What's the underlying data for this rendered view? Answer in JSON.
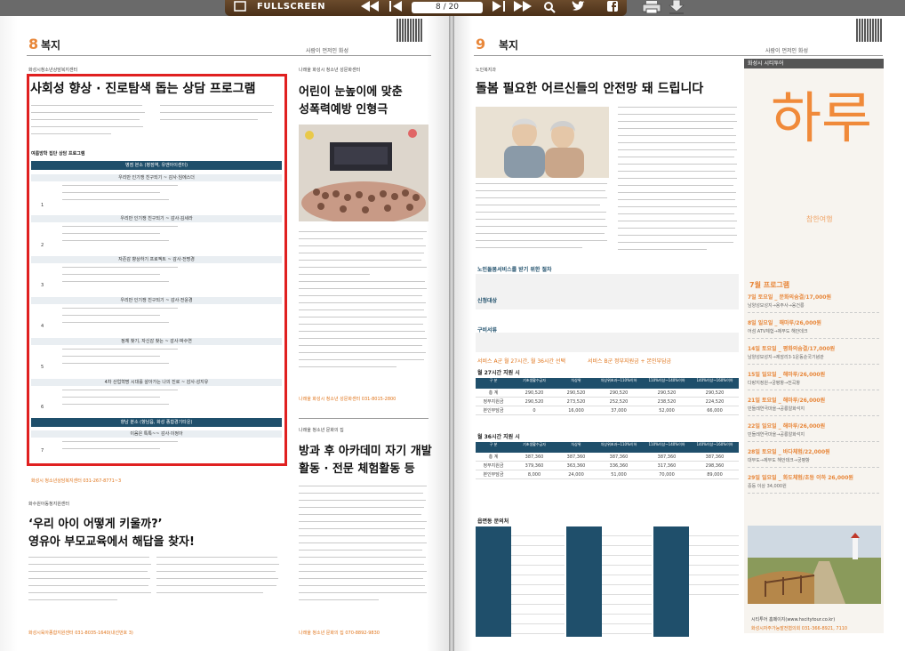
{
  "viewer": {
    "fullscreen_label": "FULLSCREEN",
    "page_counter": "8 / 20"
  },
  "left_page": {
    "number": "8",
    "section": "복지",
    "header_tag": "사람이 먼저인 화성",
    "top_tag": "화성시청소년상담복지센터",
    "article1": {
      "title": "사회성 향상 · 진로탐색 돕는 상담 프로그램",
      "table_caption": "여름방학 집단 상담 프로그램",
      "bar_main": "병점 본소 (병점역, 유앤아이센터)",
      "rows": [
        {
          "num": "1",
          "head": "우리만 인기쟁 친구되기 ~ 감사·임에스더"
        },
        {
          "num": "2",
          "head": "우리만 인기쟁 친구되기 ~ 감사·김세라"
        },
        {
          "num": "3",
          "head": "자존감 향상하기 프로젝트 ~ 감사·전명경"
        },
        {
          "num": "4",
          "head": "우리만 인기쟁 친구되기 ~ 감사·전윤경"
        },
        {
          "num": "5",
          "head": "정체 찾기, 자신감 찾는 ~ 감사·박수연"
        },
        {
          "num": "6",
          "head": "4차 산업혁명 시대를 살아가는 나의 진로 ~ 감사·성지유"
        }
      ],
      "bar_second": "향남 분소 (향남읍, 화성 종합경기타운)",
      "sub_second": "이음은 톡톡~~ 감사·이정아",
      "row7": {
        "num": "7"
      },
      "contact": "화성시 청소년상담복지센터 031-267-8771~3"
    },
    "article2": {
      "tag": "나래울 화성시 청소년 성문화센터",
      "title_lines": [
        "어린이 눈높이에 맞춘",
        "성폭력예방 인형극"
      ],
      "contact": "나래울 화성시 청소년 성문화센터 031-8015-2800"
    },
    "article3": {
      "tag": "화수원아동청지원센터",
      "title_lines": [
        "‘우리 아이 어떻게 키울까?’",
        "영유아 부모교육에서 해답을 찾자!"
      ],
      "contact": "화성시육아종합지원센터 031-8035-1640(내선번호 3)"
    },
    "article4": {
      "tag": "나래울 청소년 문화의 집",
      "title_lines": [
        "방과 후 아카데미 자기 개발",
        "활동 · 전문 체험활동 등"
      ],
      "contact": "나래울 청소년 문화의 집 070-8892-9830"
    }
  },
  "right_page": {
    "number": "9",
    "section": "복지",
    "header_tag": "사람이 먼저인 화성",
    "top_tag": "노인복지과",
    "article1": {
      "title": "돌봄 필요한 어르신들의 안전망 돼 드립니다",
      "sub_service": "노인돌봄서비스를 받기 위한 절차",
      "sub_target": "신청대상",
      "sub_area": "구비서류",
      "service_a": "서비스 A군 월 27시간, 월 36시간 선택",
      "service_b": "서비스 B군 정부지원금 + 본인부담금",
      "table1_title": "월 27시간 지원 시",
      "table2_title": "월 36시간 지원 시",
      "table_headers": [
        "구 분",
        "기초생활수급자",
        "차상위",
        "차상위초과~110%이하",
        "110%이상~140%이하",
        "140%이상~160%이하"
      ],
      "table1_rows": [
        [
          "총 계",
          "290,520",
          "290,520",
          "290,520",
          "290,520",
          "290,520"
        ],
        [
          "정부지원금",
          "290,520",
          "273,520",
          "252,520",
          "238,520",
          "224,520"
        ],
        [
          "본인부담금",
          "0",
          "16,000",
          "37,000",
          "52,000",
          "66,000"
        ]
      ],
      "table2_rows": [
        [
          "총 계",
          "387,360",
          "387,360",
          "387,360",
          "387,360",
          "387,360"
        ],
        [
          "정부지원금",
          "379,360",
          "363,360",
          "336,360",
          "317,360",
          "298,360"
        ],
        [
          "본인부담금",
          "8,000",
          "24,000",
          "51,000",
          "70,000",
          "89,000"
        ]
      ],
      "contact_title": "읍면동 문의처"
    },
    "sidebar": {
      "head": "화성시 시티투어",
      "brand": "하루",
      "brand_sub": "참한여행",
      "program_title": "7월 프로그램",
      "programs": [
        {
          "date": "7일 토요일 _ 문화의숨결/17,000원",
          "desc": "남양성모성지→용주사→융건릉"
        },
        {
          "date": "8일 일요일 _ 해마루/26,000원",
          "desc": "어섬 ATV체험→제부도 해안데크"
        },
        {
          "date": "14일 토요일 _ 평화의숨결/17,000원",
          "desc": "남양성모성지→제암리3·1운동순국기념관"
        },
        {
          "date": "15일 일요일 _ 해마루/26,000원",
          "desc": "다랑지정원→궁평항→전곡항"
        },
        {
          "date": "21일 토요일 _ 해마루/26,000원",
          "desc": "민들레연극마을→공룡알화석지"
        },
        {
          "date": "22일 일요일 _ 해마루/26,000원",
          "desc": "민들레연극마을→공룡알화석지"
        },
        {
          "date": "28일 토요일 _ 바다체험/22,000원",
          "desc": "대부도→제부도 해안데크→궁평항"
        },
        {
          "date": "29일 일요일 _ 화도체험/초등 이하 26,000원",
          "desc": "중등 이상 34,000원"
        }
      ],
      "footer": "시티투어 홈페이지(www.hscitytour.co.kr)",
      "contact": "화성시자주가능발전협의회 031-366-8921, 7110"
    }
  }
}
